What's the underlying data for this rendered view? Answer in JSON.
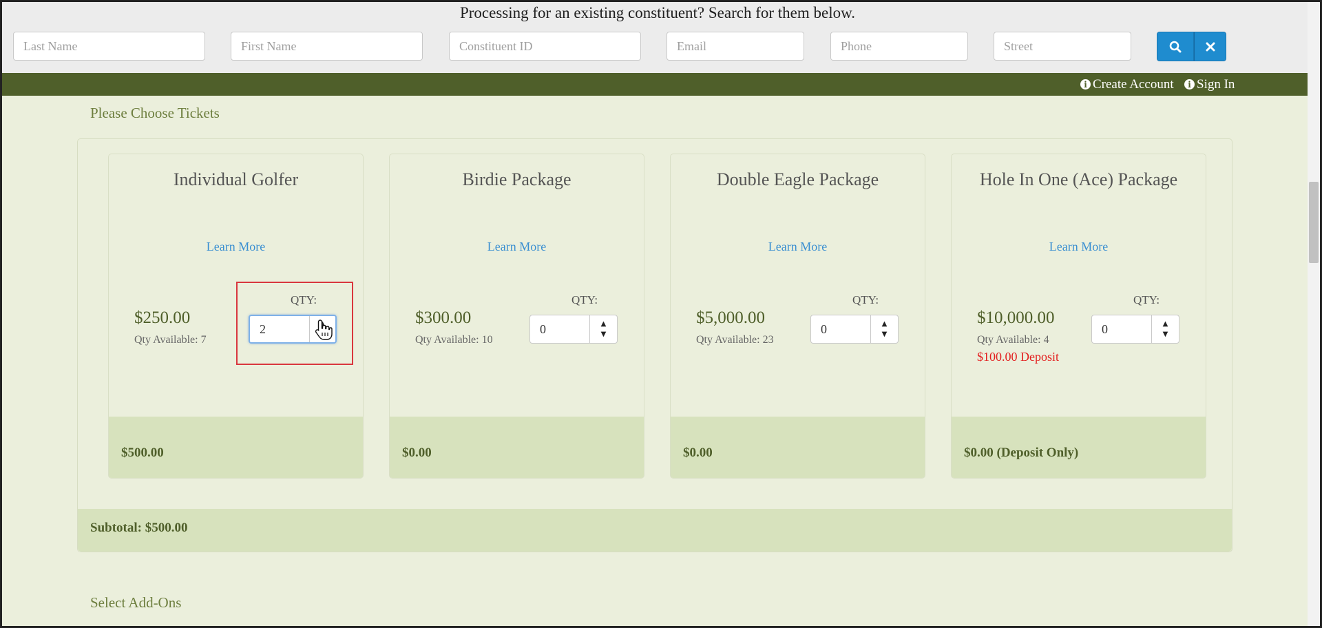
{
  "search": {
    "title": "Processing for an existing constituent? Search for them below.",
    "fields": {
      "last_name": "Last Name",
      "first_name": "First Name",
      "constituent_id": "Constituent ID",
      "email": "Email",
      "phone": "Phone",
      "street": "Street"
    },
    "search_icon": "search-icon",
    "clear_icon": "close-icon"
  },
  "nav": {
    "create_account": "Create Account",
    "sign_in": "Sign In"
  },
  "tickets": {
    "section_title": "Please Choose Tickets",
    "qty_label": "QTY:",
    "learn_more": "Learn More",
    "items": [
      {
        "name": "Individual Golfer",
        "price": "$250.00",
        "qty_available": "Qty Available: 7",
        "qty": "2",
        "total": "$500.00"
      },
      {
        "name": "Birdie Package",
        "price": "$300.00",
        "qty_available": "Qty Available: 10",
        "qty": "0",
        "total": "$0.00"
      },
      {
        "name": "Double Eagle Package",
        "price": "$5,000.00",
        "qty_available": "Qty Available: 23",
        "qty": "0",
        "total": "$0.00"
      },
      {
        "name": "Hole In One (Ace) Package",
        "price": "$10,000.00",
        "qty_available": "Qty Available: 4",
        "deposit": "$100.00 Deposit",
        "qty": "0",
        "total": "$0.00 (Deposit Only)"
      }
    ],
    "subtotal": "Subtotal: $500.00"
  },
  "addons": {
    "section_title": "Select Add-Ons"
  },
  "colors": {
    "nav_green": "#4f5f2a",
    "panel_bg": "#ebefdc",
    "footer_bg": "#d7e2bd",
    "link_blue": "#3a8fd1",
    "button_blue": "#1f8ccf",
    "deposit_red": "#e31e1e"
  }
}
